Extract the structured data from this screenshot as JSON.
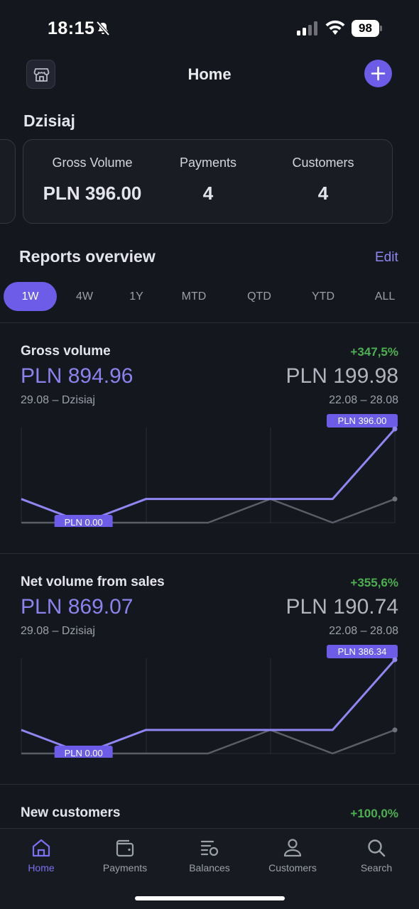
{
  "status_bar": {
    "time": "18:15",
    "battery": "98"
  },
  "header": {
    "title": "Home"
  },
  "today": {
    "title": "Dzisiaj",
    "metrics": [
      {
        "label": "Gross Volume",
        "value": "PLN 396.00"
      },
      {
        "label": "Payments",
        "value": "4"
      },
      {
        "label": "Customers",
        "value": "4"
      }
    ]
  },
  "reports": {
    "title": "Reports overview",
    "edit_label": "Edit",
    "periods": [
      "1W",
      "4W",
      "1Y",
      "MTD",
      "QTD",
      "YTD",
      "ALL"
    ],
    "active_period": "1W",
    "cards": [
      {
        "title": "Gross volume",
        "change": "+347,5%",
        "current_value": "PLN 894.96",
        "current_range": "29.08 – Dzisiaj",
        "previous_value": "PLN 199.98",
        "previous_range": "22.08 – 28.08",
        "max_label": "PLN 396.00",
        "min_label": "PLN 0.00"
      },
      {
        "title": "Net volume from sales",
        "change": "+355,6%",
        "current_value": "PLN 869.07",
        "current_range": "29.08 – Dzisiaj",
        "previous_value": "PLN 190.74",
        "previous_range": "22.08 – 28.08",
        "max_label": "PLN 386.34",
        "min_label": "PLN 0.00"
      },
      {
        "title": "New customers",
        "change": "+100,0%"
      }
    ]
  },
  "chart_data": [
    {
      "type": "line",
      "x": [
        1,
        2,
        3,
        4,
        5,
        6,
        7
      ],
      "series": [
        {
          "values": [
            100,
            0,
            100,
            100,
            100,
            100,
            396
          ]
        },
        {
          "values": [
            0,
            0,
            0,
            0,
            100,
            0,
            100
          ]
        }
      ],
      "ylim": [
        0,
        396
      ]
    },
    {
      "type": "line",
      "x": [
        1,
        2,
        3,
        4,
        5,
        6,
        7
      ],
      "series": [
        {
          "values": [
            97,
            0,
            97,
            97,
            97,
            97,
            386.34
          ]
        },
        {
          "values": [
            0,
            0,
            0,
            0,
            97,
            0,
            97
          ]
        }
      ],
      "ylim": [
        0,
        386.34
      ]
    }
  ],
  "tabbar": {
    "items": [
      {
        "label": "Home",
        "icon": "home-icon"
      },
      {
        "label": "Payments",
        "icon": "wallet-icon"
      },
      {
        "label": "Balances",
        "icon": "balances-icon"
      },
      {
        "label": "Customers",
        "icon": "user-icon"
      },
      {
        "label": "Search",
        "icon": "search-icon"
      }
    ],
    "active": "Home"
  },
  "colors": {
    "background": "#15171e",
    "accent": "#6c5ce7",
    "series_current": "#8f86f2",
    "series_previous": "#5b5e68",
    "positive": "#4caf50"
  }
}
